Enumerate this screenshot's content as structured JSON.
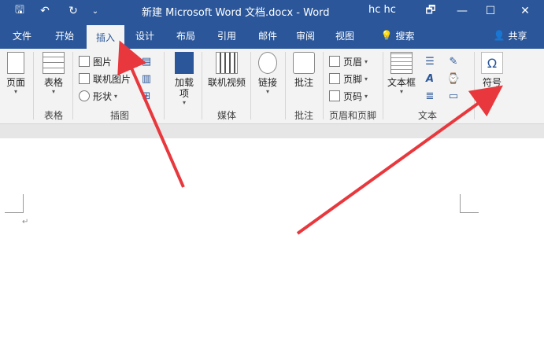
{
  "titlebar": {
    "title": "新建 Microsoft Word 文档.docx  -  Word",
    "user": "hc hc",
    "qa_save": "🖫",
    "qa_undo": "↶",
    "qa_redo": "↻",
    "qa_customize": "⌄",
    "restore": "🗗",
    "minimize": "—",
    "maximize": "☐",
    "close": "✕"
  },
  "tabs": [
    {
      "label": "文件"
    },
    {
      "label": "开始"
    },
    {
      "label": "插入"
    },
    {
      "label": "设计"
    },
    {
      "label": "布局"
    },
    {
      "label": "引用"
    },
    {
      "label": "邮件"
    },
    {
      "label": "审阅"
    },
    {
      "label": "视图"
    }
  ],
  "tell_me": "搜索",
  "share": "共享",
  "ribbon": {
    "pages": {
      "label": "页面"
    },
    "table": {
      "label": "表格",
      "group": "表格"
    },
    "illustrations": {
      "group": "插图",
      "picture": "图片",
      "online_picture": "联机图片",
      "shapes": "形状"
    },
    "addins": {
      "label": "加载\n项"
    },
    "media": {
      "label": "联机视频",
      "group": "媒体"
    },
    "links": {
      "label": "链接"
    },
    "comments": {
      "label": "批注",
      "group": "批注"
    },
    "header_footer": {
      "group": "页眉和页脚",
      "header": "页眉",
      "footer": "页脚",
      "page_number": "页码"
    },
    "text": {
      "group": "文本",
      "textbox": "文本框"
    },
    "symbols": {
      "label": "符号",
      "icon": "Ω"
    }
  },
  "document": {
    "para_mark": "↵"
  },
  "colors": {
    "accent": "#2b579a",
    "arrow": "#e8383d"
  }
}
